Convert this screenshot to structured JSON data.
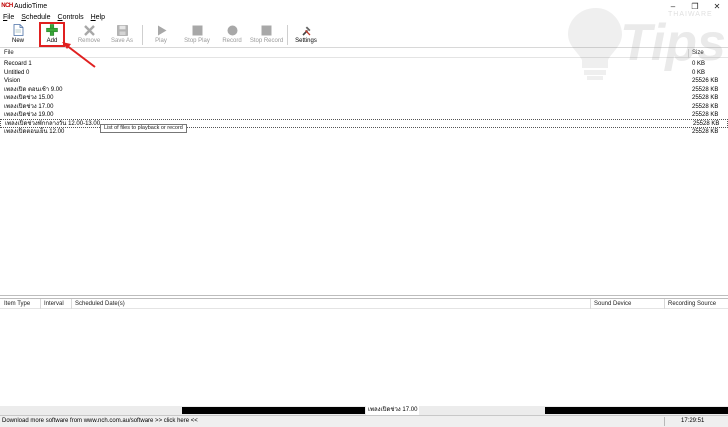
{
  "window": {
    "logo_text": "NCH",
    "title": "AudioTime",
    "minimize_glyph": "–",
    "maximize_glyph": "❐",
    "close_glyph": "✕"
  },
  "menu": [
    {
      "key": "F",
      "rest": "ile"
    },
    {
      "key": "S",
      "rest": "chedule"
    },
    {
      "key": "C",
      "rest": "ontrols"
    },
    {
      "key": "H",
      "rest": "elp"
    }
  ],
  "toolbar": {
    "new": "New",
    "add": "Add",
    "remove": "Remove",
    "save_as": "Save As",
    "play": "Play",
    "stop_play": "Stop Play",
    "record": "Record",
    "stop_record": "Stop Record",
    "settings": "Settings"
  },
  "colors": {
    "highlight": "#e02020",
    "add_icon": "#3aa83a",
    "disabled_icon": "#a8a8a8"
  },
  "file_list": {
    "columns": [
      "File",
      "Size"
    ],
    "rows": [
      {
        "name": "Recoard 1",
        "size": "0 KB"
      },
      {
        "name": "Untitled 0",
        "size": "0 KB"
      },
      {
        "name": "Vision",
        "size": "25526 KB"
      },
      {
        "name": "เพลงเปิด ตอนเช้า 9.00",
        "size": "25528 KB"
      },
      {
        "name": "เพลงเปิดช่วง 15.00",
        "size": "25528 KB"
      },
      {
        "name": "เพลงเปิดช่วง 17.00",
        "size": "25528 KB"
      },
      {
        "name": "เพลงเปิดช่วง 19.00",
        "size": "25528 KB"
      },
      {
        "name": "เพลงเปิดช่วงพักกลางวัน 12.00-13.00",
        "size": "25528 KB"
      },
      {
        "name": "เพลงเปิดตอนเย็น 12.00",
        "size": "25528 KB"
      }
    ],
    "tooltip": "List of files to playback or record"
  },
  "schedule": {
    "columns": [
      "Item Type",
      "Interval",
      "Scheduled Date(s)",
      "Sound Device",
      "Recording Source"
    ]
  },
  "status": {
    "now_playing": "เพลงเปิดช่วง 17.00",
    "link_text": "Download more software from www.nch.com.au/software >> click here <<",
    "time": "17:29:51"
  },
  "watermark": {
    "main": "Tips",
    "brand": "THAIWARE"
  }
}
